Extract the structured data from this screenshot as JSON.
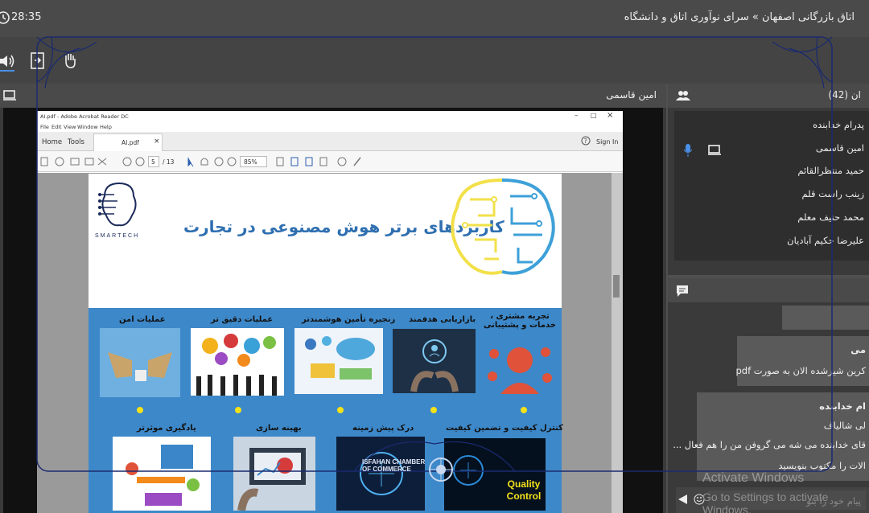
{
  "header": {
    "timer": "28:35",
    "title": "اتاق بازرگانی اصفهان » سرای نوآوری اتاق و دانشگاه"
  },
  "stage": {
    "presenter": "امین قاسمی"
  },
  "pdf": {
    "window_title": "AI.pdf - Adobe Acrobat Reader DC",
    "menu": [
      "File",
      "Edit",
      "View",
      "Window",
      "Help"
    ],
    "tabs": {
      "home": "Home",
      "tools": "Tools",
      "file": "AI.pdf",
      "close": "×"
    },
    "sign_in": "Sign In",
    "page_current": "5",
    "page_total": "/ 13",
    "zoom": "85%"
  },
  "slide": {
    "logo_text": "SMARTECH",
    "title": "کاربردهای برتر هوش مصنوعی در تجارت",
    "row1": [
      "عملیات امن",
      "عملیات دقیق تر",
      "زنجیره تأمین هوشمندتر",
      "بازاریابی هدفمند",
      "تجربه مشتری ، خدمات و پشتیبانی"
    ],
    "row2": [
      "یادگیری موثرتر",
      "بهینه سازی",
      "درک پیش زمینه",
      "کنترل کیفیت و تضمین کیفیت"
    ],
    "qc_label": "Quality Control"
  },
  "participants": {
    "count_label": "ان (42)",
    "list": [
      "پدرام خدابنده",
      "امین قاسمی",
      "حمید منتظرالقائم",
      "زینب راست قلم",
      "محمد حنیف معلم",
      "علیرضا حکیم آبادیان"
    ]
  },
  "chat": {
    "messages": [
      "می",
      "کرین شیرشده الان به صورت pdf",
      "ام خدابنده",
      "لی شالیاف",
      "قای خدابنده می شه می گروفن من را هم فعال ...",
      "الات را مکتوب بنویسید"
    ],
    "input_placeholder": "پیام خود را بنو"
  },
  "overlay": {
    "watermark_line1": "Activate Windows",
    "watermark_line2": "Go to Settings to activate Windows.",
    "logo_text": "ISFAHAN CHAMBER OF COMMERCE"
  },
  "colors": {
    "slide_blue": "#3d88c9",
    "mic_blue": "#4a8fe8",
    "frame_line": "#1a2a6e"
  }
}
